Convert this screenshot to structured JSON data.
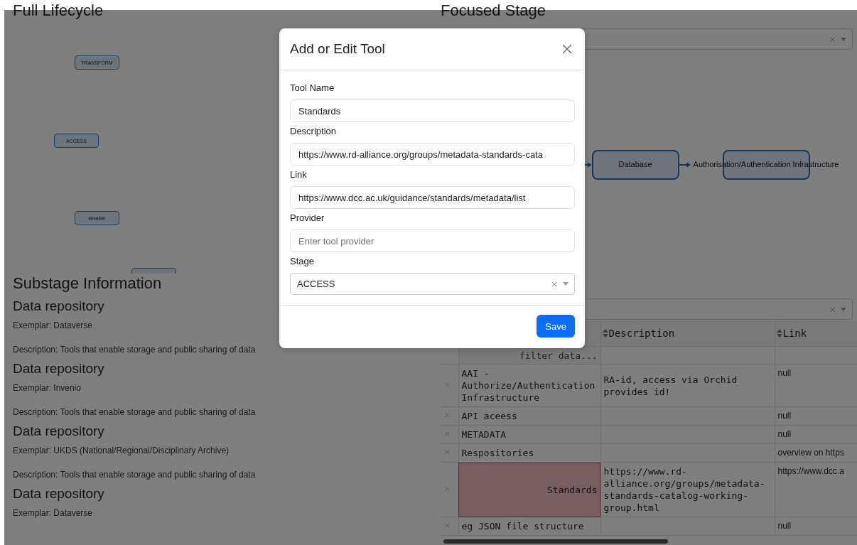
{
  "full_lifecycle": {
    "title": "Full Lifecycle",
    "nodes": [
      {
        "label": "TRANSFORM"
      },
      {
        "label": "ACCESS"
      },
      {
        "label": "SHARE"
      }
    ]
  },
  "substage_information": {
    "title": "Substage Information",
    "items": [
      {
        "name": "Data repository",
        "exemplar": "Exemplar: Dataverse",
        "description": "Description: Tools that enable storage and public sharing of data"
      },
      {
        "name": "Data repository",
        "exemplar": "Exemplar: Invenio",
        "description": "Description: Tools that enable storage and public sharing of data"
      },
      {
        "name": "Data repository",
        "exemplar": "Exemplar: UKDS (National/Regional/Disciplinary Archive)",
        "description": "Description: Tools that enable storage and public sharing of data"
      },
      {
        "name": "Data repository",
        "exemplar": "Exemplar: Dataverse"
      }
    ]
  },
  "focused_stage": {
    "title": "Focused Stage",
    "nodes": [
      {
        "label": "Database"
      },
      {
        "label": "Authorisation/Authentication Infrastructure"
      }
    ]
  },
  "tools_table": {
    "columns": [
      {
        "label": "Description"
      },
      {
        "label": "Link"
      }
    ],
    "filter_placeholder": "filter data...",
    "rows": [
      {
        "name": "AAI - Authorize/Authentication Infrastructure",
        "description": "RA-id, access via Orchid provides id!",
        "link": "null",
        "highlighted": false
      },
      {
        "name": "API aceess",
        "link": "null",
        "highlighted": false
      },
      {
        "name": "METADATA",
        "link": "null",
        "highlighted": false
      },
      {
        "name": "Respositories",
        "link": "overview on https",
        "highlighted": false
      },
      {
        "name": "Standards",
        "description": "https://www.rd-alliance.org/groups/metadata-standards-catalog-working-group.html",
        "link": "https://www.dcc.a",
        "highlighted": true
      },
      {
        "name": "eg JSON file structure",
        "link": "null",
        "highlighted": false
      }
    ]
  },
  "modal": {
    "title": "Add or Edit Tool",
    "fields": [
      {
        "kind": "text",
        "label": "Tool Name",
        "value": "Standards"
      },
      {
        "kind": "text",
        "label": "Description",
        "value": "https://www.rd-alliance.org/groups/metadata-standards-cata"
      },
      {
        "kind": "text",
        "label": "Link",
        "value": "https://www.dcc.ac.uk/guidance/standards/metadata/list"
      },
      {
        "kind": "text",
        "label": "Provider",
        "placeholder": "Enter tool provider"
      },
      {
        "kind": "select",
        "label": "Stage",
        "value": "ACCESS"
      }
    ],
    "save_button": "Save"
  }
}
